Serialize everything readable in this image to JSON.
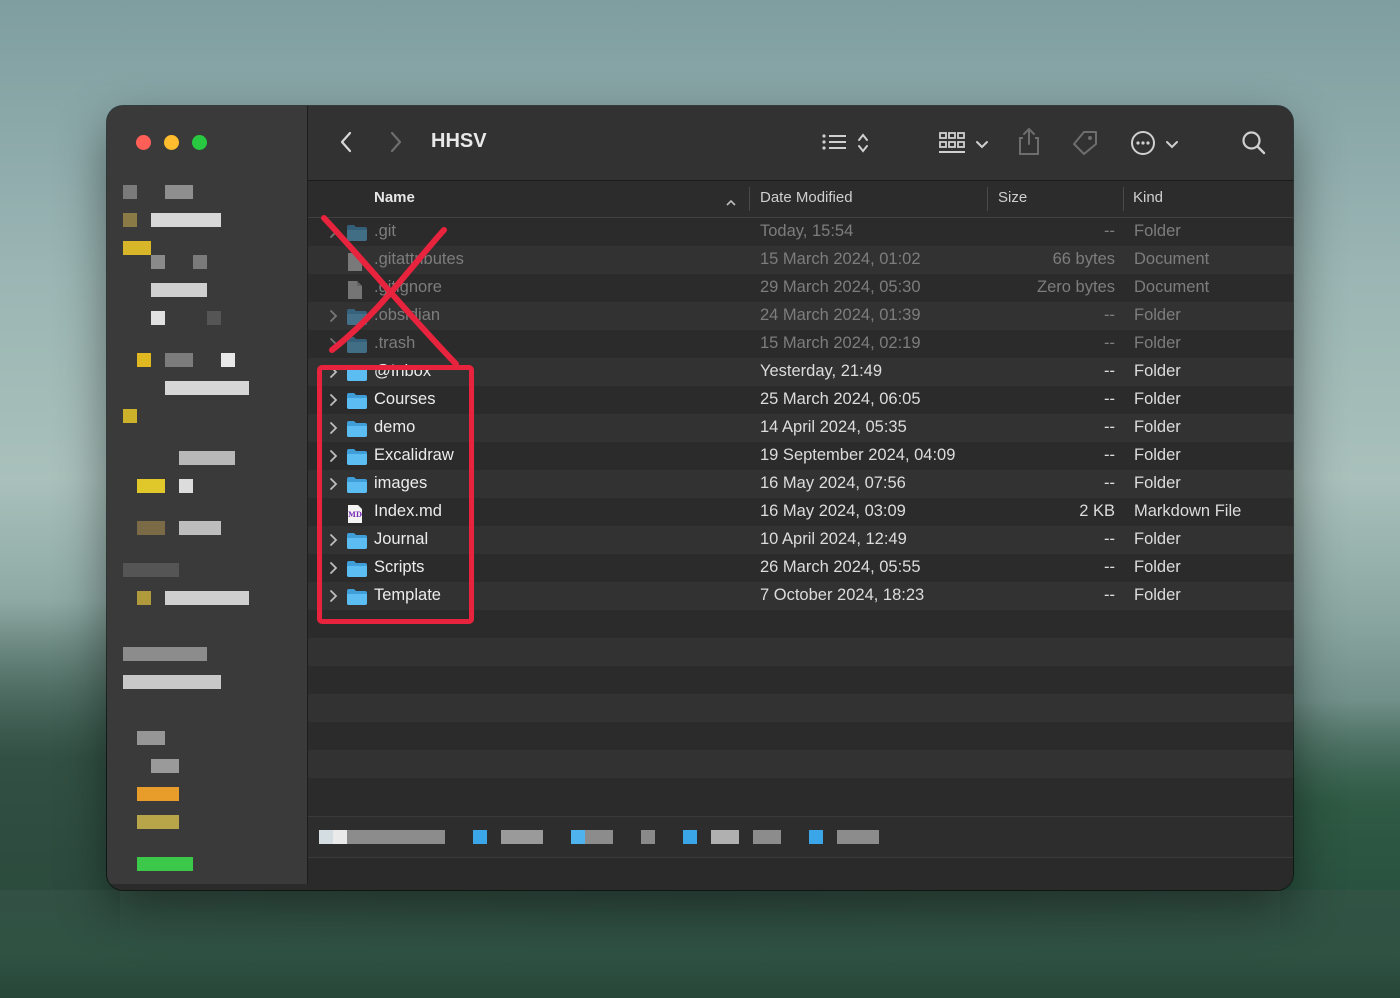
{
  "window": {
    "title": "HHSV",
    "traffic_colors": {
      "close": "#ff5f57",
      "minimize": "#febc2e",
      "maximize": "#28c840"
    }
  },
  "toolbar": {
    "icons": [
      "chevron-left-icon",
      "chevron-right-icon",
      "list-view-icon",
      "sort-updown-icon",
      "grid-view-icon",
      "chevron-down-icon",
      "share-icon",
      "tag-icon",
      "more-icon",
      "search-icon"
    ]
  },
  "columns": {
    "name": "Name",
    "date_modified": "Date Modified",
    "size": "Size",
    "kind": "Kind"
  },
  "files": [
    {
      "name": ".git",
      "date": "Today, 15:54",
      "size": "--",
      "kind": "Folder",
      "type": "folder",
      "dimmed": true
    },
    {
      "name": ".gitattributes",
      "date": "15 March 2024, 01:02",
      "size": "66 bytes",
      "kind": "Document",
      "type": "doc",
      "dimmed": true
    },
    {
      "name": ".gitignore",
      "date": "29 March 2024, 05:30",
      "size": "Zero bytes",
      "kind": "Document",
      "type": "doc",
      "dimmed": true
    },
    {
      "name": ".obsidian",
      "date": "24 March 2024, 01:39",
      "size": "--",
      "kind": "Folder",
      "type": "folder",
      "dimmed": true
    },
    {
      "name": ".trash",
      "date": "15 March 2024, 02:19",
      "size": "--",
      "kind": "Folder",
      "type": "folder",
      "dimmed": true
    },
    {
      "name": "@Inbox",
      "date": "Yesterday, 21:49",
      "size": "--",
      "kind": "Folder",
      "type": "folder",
      "dimmed": false
    },
    {
      "name": "Courses",
      "date": "25 March 2024, 06:05",
      "size": "--",
      "kind": "Folder",
      "type": "folder",
      "dimmed": false
    },
    {
      "name": "demo",
      "date": "14 April 2024, 05:35",
      "size": "--",
      "kind": "Folder",
      "type": "folder",
      "dimmed": false
    },
    {
      "name": "Excalidraw",
      "date": "19 September 2024, 04:09",
      "size": "--",
      "kind": "Folder",
      "type": "folder",
      "dimmed": false
    },
    {
      "name": "images",
      "date": "16 May 2024, 07:56",
      "size": "--",
      "kind": "Folder",
      "type": "folder",
      "dimmed": false
    },
    {
      "name": "Index.md",
      "date": "16 May 2024, 03:09",
      "size": "2 KB",
      "kind": "Markdown File",
      "type": "md",
      "dimmed": false
    },
    {
      "name": "Journal",
      "date": "10 April 2024, 12:49",
      "size": "--",
      "kind": "Folder",
      "type": "folder",
      "dimmed": false
    },
    {
      "name": "Scripts",
      "date": "26 March 2024, 05:55",
      "size": "--",
      "kind": "Folder",
      "type": "folder",
      "dimmed": false
    },
    {
      "name": "Template",
      "date": "7 October 2024, 18:23",
      "size": "--",
      "kind": "Folder",
      "type": "folder",
      "dimmed": false
    }
  ],
  "md_badge": "MD",
  "annotations": {
    "highlight_color": "#e8233d"
  },
  "colors": {
    "folder_blue": "#4fb3ee",
    "window_bg": "#2b2b2b",
    "sidebar_bg": "#3a3a3a"
  }
}
